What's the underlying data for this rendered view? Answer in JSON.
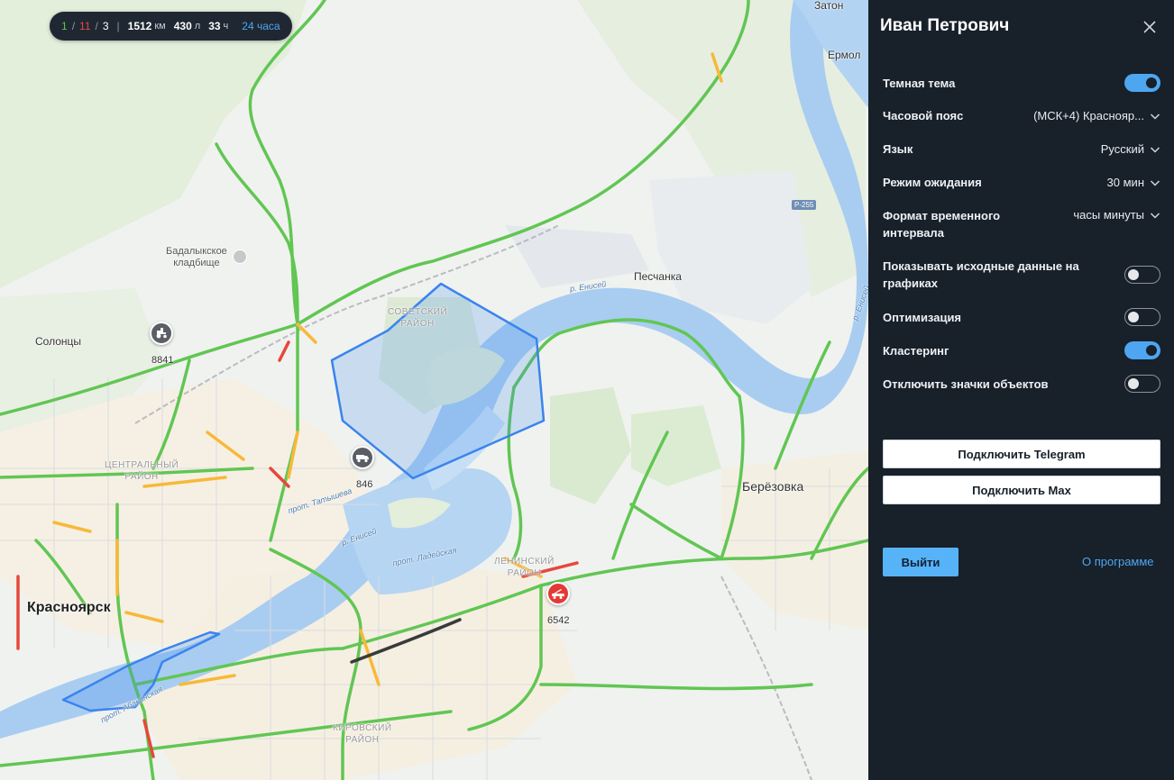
{
  "stats": {
    "online": "1",
    "offline": "11",
    "other": "3",
    "distance_value": "1512",
    "distance_unit": "км",
    "fuel_value": "430",
    "fuel_unit": "л",
    "hours_value": "33",
    "hours_unit": "ч",
    "period_link": "24 часа"
  },
  "map": {
    "labels": {
      "zaton": "Затон",
      "ermolaevo": "Ермол",
      "badalyk": "Бадалыкское\nкладбище",
      "solontsy": "Солонцы",
      "peschanka": "Песчанка",
      "sovetsky": "СОВЕТСКИЙ\nРАЙОН",
      "tsentralny": "ЦЕНТРАЛЬНЫЙ\nРАЙОН",
      "leninsky": "ЛЕНИНСКИЙ\nРАЙОН",
      "kirovsky": "КИРОВСКИЙ\nРАЙОН",
      "krasnoyarsk": "Красноярск",
      "berezovka": "Берёзовка",
      "river_yenisei_1": "р. Енисей",
      "river_yenisei_2": "р. Енисей",
      "river_yenisei_3": "р. Енисей",
      "prot_tatysheva": "прот. Татышева",
      "prot_ladeyskaya": "прот. Ладейская",
      "prot_abakanskaya": "прот. Абаканская",
      "road_r255": "Р-255"
    },
    "markers": [
      {
        "id": "8841",
        "label": "8841",
        "color": "#5a5f66"
      },
      {
        "id": "846",
        "label": "846",
        "color": "#5a5f66"
      },
      {
        "id": "6542",
        "label": "6542",
        "color": "#e53935"
      }
    ]
  },
  "panel": {
    "title": "Иван Петрович",
    "settings": {
      "dark_theme": {
        "label": "Темная тема",
        "on": true
      },
      "timezone": {
        "label": "Часовой пояс",
        "value": "(МСК+4) Краснояр..."
      },
      "language": {
        "label": "Язык",
        "value": "Русский"
      },
      "standby": {
        "label": "Режим ожидания",
        "value": "30 мин"
      },
      "time_format": {
        "label": "Формат временного\nинтервала",
        "value": "часы минуты"
      },
      "show_raw": {
        "label": "Показывать исходные данные на\nграфиках",
        "on": false
      },
      "optimization": {
        "label": "Оптимизация",
        "on": false
      },
      "clustering": {
        "label": "Кластеринг",
        "on": true
      },
      "hide_icons": {
        "label": "Отключить значки объектов",
        "on": false
      }
    },
    "buttons": {
      "telegram": "Подключить Telegram",
      "max": "Подключить Max",
      "logout": "Выйти",
      "about": "О программе"
    },
    "accent_color": "#4ea6f0",
    "background_color": "#18202a"
  }
}
